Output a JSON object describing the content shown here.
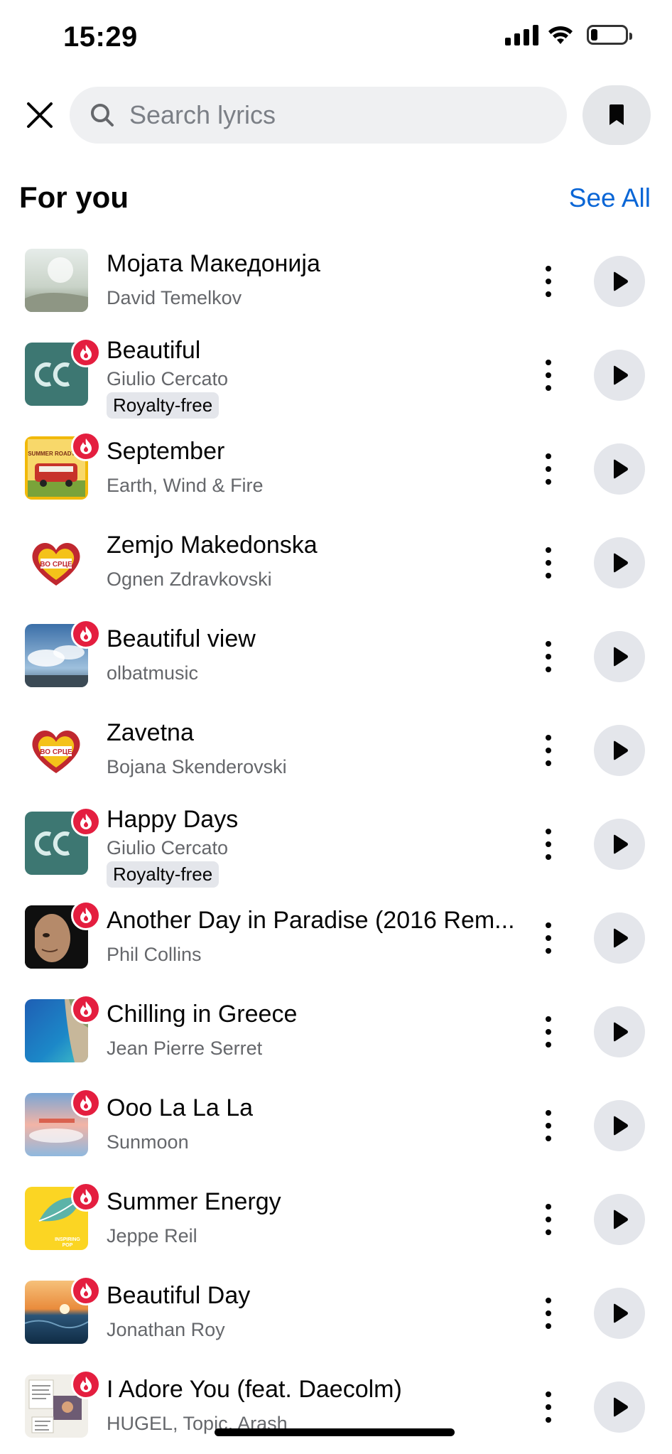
{
  "status_bar": {
    "time": "15:29",
    "battery_level": 0.2
  },
  "search": {
    "placeholder": "Search lyrics",
    "value": "",
    "icon": "search-icon"
  },
  "icons": {
    "close": "close-icon",
    "bookmark": "bookmark-icon",
    "more": "more-vertical-icon",
    "play": "play-icon",
    "trending": "fire-icon"
  },
  "section": {
    "title": "For you",
    "see_all_label": "See All"
  },
  "tracks": [
    {
      "title": "Мојата Македонија",
      "artist": "David Temelkov",
      "tag": "",
      "hot": false,
      "art": "sky"
    },
    {
      "title": "Beautiful",
      "artist": "Giulio Cercato",
      "tag": "Royalty-free",
      "hot": true,
      "art": "gc"
    },
    {
      "title": "September",
      "artist": "Earth, Wind & Fire",
      "tag": "",
      "hot": true,
      "art": "bus"
    },
    {
      "title": "Zemjo Makedonska",
      "artist": "Ognen Zdravkovski",
      "tag": "",
      "hot": false,
      "art": "heart"
    },
    {
      "title": "Beautiful view",
      "artist": "olbatmusic",
      "tag": "",
      "hot": true,
      "art": "clouds"
    },
    {
      "title": "Zavetna",
      "artist": "Bojana Skenderovski",
      "tag": "",
      "hot": false,
      "art": "heart"
    },
    {
      "title": "Happy Days",
      "artist": "Giulio Cercato",
      "tag": "Royalty-free",
      "hot": true,
      "art": "gc"
    },
    {
      "title": "Another Day in Paradise (2016 Rem...",
      "artist": "Phil Collins",
      "tag": "",
      "hot": true,
      "art": "portrait"
    },
    {
      "title": "Chilling in Greece",
      "artist": "Jean Pierre Serret",
      "tag": "",
      "hot": true,
      "art": "sea"
    },
    {
      "title": "Ooo La La La",
      "artist": "Sunmoon",
      "tag": "",
      "hot": true,
      "art": "sunset"
    },
    {
      "title": "Summer Energy",
      "artist": "Jeppe Reil",
      "tag": "",
      "hot": true,
      "art": "yellow"
    },
    {
      "title": "Beautiful Day",
      "artist": "Jonathan Roy",
      "tag": "",
      "hot": true,
      "art": "ocean"
    },
    {
      "title": "I Adore You (feat. Daecolm)",
      "artist": "HUGEL, Topic, Arash",
      "tag": "",
      "hot": true,
      "art": "collage"
    }
  ],
  "colors": {
    "accent": "#0a66d6",
    "hot_badge": "#e41e3f",
    "secondary_text": "#65676b",
    "button_bg": "#e4e6eb"
  }
}
